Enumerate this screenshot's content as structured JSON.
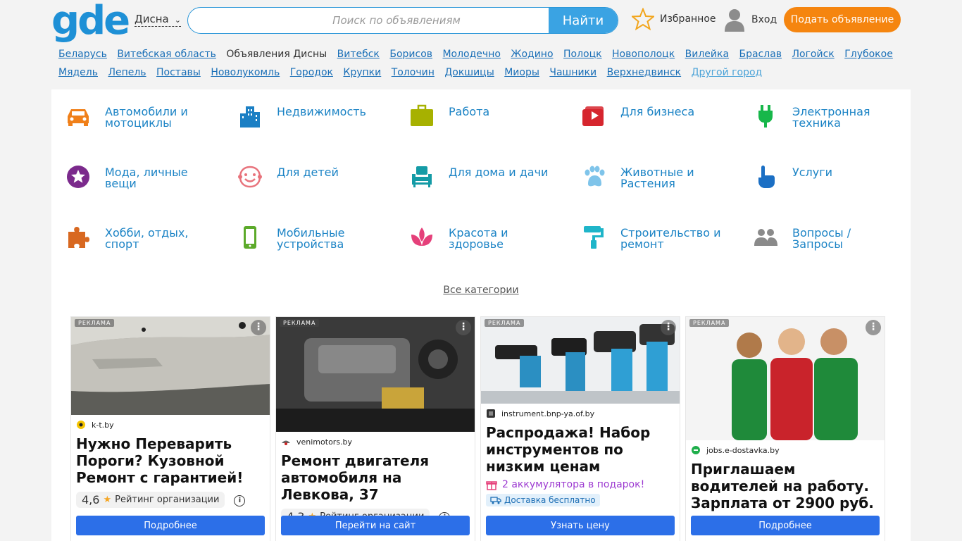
{
  "header": {
    "logo": "gde",
    "city": "Дисна",
    "search_placeholder": "Поиск по объявлениям",
    "search_button": "Найти",
    "favorites": "Избранное",
    "login": "Вход",
    "post_ad": "Подать объявление"
  },
  "cities": {
    "items": [
      "Беларусь",
      "Витебская область",
      "Объявления Дисны",
      "Витебск",
      "Борисов",
      "Молодечно",
      "Жодино",
      "Полоцк",
      "Новополоцк",
      "Вилейка",
      "Браслав",
      "Логойск",
      "Глубокое",
      "Мядель",
      "Лепель",
      "Поставы",
      "Новолукомль",
      "Городок",
      "Крупки",
      "Толочин",
      "Докшицы",
      "Миоры",
      "Чашники",
      "Верхнедвинск"
    ],
    "current_index": 2,
    "other": "Другой город"
  },
  "categories": [
    {
      "label": "Автомобили и мотоциклы",
      "icon": "car-icon",
      "color": "#f0801a"
    },
    {
      "label": "Недвижимость",
      "icon": "buildings-icon",
      "color": "#1b7fc4"
    },
    {
      "label": "Работа",
      "icon": "briefcase-icon",
      "color": "#a7b100"
    },
    {
      "label": "Для бизнеса",
      "icon": "video-play-icon",
      "color": "#d6262e"
    },
    {
      "label": "Электронная техника",
      "icon": "plug-icon",
      "color": "#17b74a"
    },
    {
      "label": "Мода, личные вещи",
      "icon": "star-badge-icon",
      "color": "#7b2a8c"
    },
    {
      "label": "Для детей",
      "icon": "smiley-icon",
      "color": "#e8737c"
    },
    {
      "label": "Для дома и дачи",
      "icon": "armchair-icon",
      "color": "#149ba6"
    },
    {
      "label": "Животные и Растения",
      "icon": "paw-icon",
      "color": "#7fc4ea"
    },
    {
      "label": "Услуги",
      "icon": "hand-pointer-icon",
      "color": "#1b6fc4"
    },
    {
      "label": "Хобби, отдых, спорт",
      "icon": "puzzle-icon",
      "color": "#d86820"
    },
    {
      "label": "Мобильные устройства",
      "icon": "phone-icon",
      "color": "#5caa2a"
    },
    {
      "label": "Красота и здоровье",
      "icon": "lotus-icon",
      "color": "#e5407a"
    },
    {
      "label": "Строительство и ремонт",
      "icon": "paint-roller-icon",
      "color": "#1fb5c9"
    },
    {
      "label": "Вопросы / Запросы",
      "icon": "people-icon",
      "color": "#8a8a8a"
    }
  ],
  "all_categories": "Все категории",
  "ads": [
    {
      "badge": "РЕКЛАМА",
      "domain": "k-t.by",
      "title": "Нужно Переварить Пороги? Кузовной Ремонт с гарантией!",
      "rating": "4,6",
      "rating_label": "Рейтинг организации",
      "cta": "Подробнее"
    },
    {
      "badge": "РЕКЛАМА",
      "domain": "venimotors.by",
      "title": "Ремонт двигателя автомобиля на Левкова, 37",
      "rating": "4,3",
      "rating_label": "Рейтинг организации",
      "cta": "Перейти на сайт"
    },
    {
      "badge": "РЕКЛАМА",
      "domain": "instrument.bnp-ya.of.by",
      "title": "Распродажа! Набор инструментов по низким ценам",
      "gift": "2 аккумулятора в подарок!",
      "delivery": "Доставка бесплатно",
      "cta": "Узнать цену"
    },
    {
      "badge": "РЕКЛАМА",
      "domain": "jobs.e-dostavka.by",
      "title": "Приглашаем водителей на работу. Зарплата от 2900 руб.",
      "cta": "Подробнее"
    }
  ],
  "colors": {
    "brand": "#1e90d6",
    "accent": "#f5850f",
    "link": "#1a6fb7",
    "cta": "#2c6fe8"
  }
}
